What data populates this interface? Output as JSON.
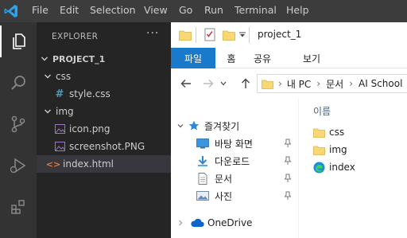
{
  "vscode": {
    "menu": [
      "File",
      "Edit",
      "Selection",
      "View",
      "Go",
      "Run",
      "Terminal",
      "Help"
    ],
    "explorer_title": "EXPLORER",
    "more_label": "···",
    "project": "PROJECT_1",
    "tree": [
      {
        "label": "css",
        "kind": "folder"
      },
      {
        "label": "style.css",
        "kind": "css"
      },
      {
        "label": "img",
        "kind": "folder"
      },
      {
        "label": "icon.png",
        "kind": "image"
      },
      {
        "label": "screenshot.PNG",
        "kind": "image"
      },
      {
        "label": "index.html",
        "kind": "html",
        "selected": true
      }
    ],
    "activity_icons": [
      "files-icon",
      "search-icon",
      "source-control-icon",
      "run-debug-icon",
      "extensions-icon"
    ],
    "colors": {
      "accent": "#3c99d4",
      "html": "#e37933",
      "css": "#519aba",
      "image": "#a074c4"
    }
  },
  "win_explorer": {
    "window_title": "project_1",
    "ribbon_tabs": [
      "파일",
      "홈",
      "공유",
      "보기"
    ],
    "breadcrumb": [
      "내 PC",
      "문서",
      "AI School"
    ],
    "column_header": "이름",
    "nav": {
      "quick_access": "즐겨찾기",
      "items": [
        "바탕 화면",
        "다운로드",
        "문서",
        "사진"
      ],
      "onedrive": "OneDrive"
    },
    "files": [
      {
        "name": "css",
        "type": "folder"
      },
      {
        "name": "img",
        "type": "folder"
      },
      {
        "name": "index",
        "type": "edge-html"
      }
    ],
    "colors": {
      "ribbon_file": "#1979ca",
      "folder": "#f8d775"
    }
  }
}
